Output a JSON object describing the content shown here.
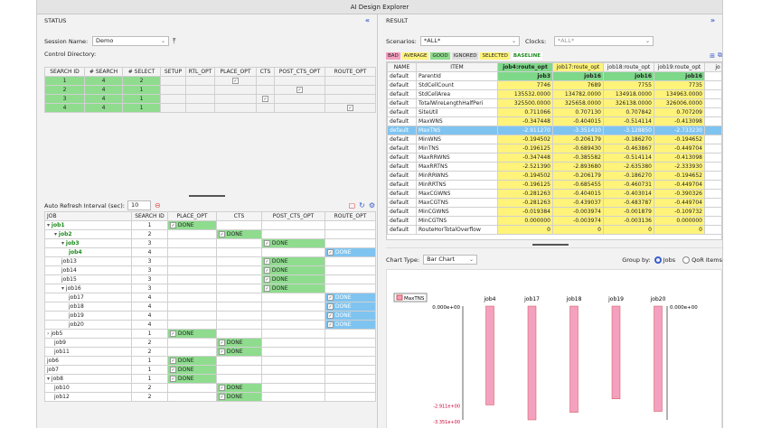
{
  "window": {
    "title": "AI Design Explorer"
  },
  "status": {
    "header": "STATUS",
    "collapse": "«",
    "session_label": "Session Name:",
    "session_value": "Demo",
    "control_dir_label": "Control Directory:",
    "table": {
      "headers": [
        "SEARCH ID",
        "# SEARCH",
        "# SELECT",
        "SETUP",
        "RTL_OPT",
        "PLACE_OPT",
        "CTS",
        "POST_CTS_OPT",
        "ROUTE_OPT"
      ],
      "rows": [
        [
          "1",
          "4",
          "2"
        ],
        [
          "2",
          "4",
          "1"
        ],
        [
          "3",
          "4",
          "1"
        ],
        [
          "4",
          "4",
          "1"
        ]
      ]
    },
    "auto_refresh_label": "Auto Refresh Interval (sec):",
    "auto_refresh_value": "10",
    "jobs_headers": [
      "JOB",
      "SEARCH ID",
      "PLACE_OPT",
      "CTS",
      "POST_CTS_OPT",
      "ROUTE_OPT"
    ],
    "done": "DONE",
    "jobs": [
      {
        "name": "job1",
        "sid": "1",
        "level": 0,
        "exp": "▾",
        "place": true,
        "cts": false,
        "post": false,
        "route": false,
        "green": true
      },
      {
        "name": "job2",
        "sid": "2",
        "level": 1,
        "exp": "▾",
        "place": false,
        "cts": true,
        "post": false,
        "route": false,
        "green": true
      },
      {
        "name": "job3",
        "sid": "3",
        "level": 2,
        "exp": "▾",
        "place": false,
        "cts": false,
        "post": true,
        "route": false,
        "green": true
      },
      {
        "name": "job4",
        "sid": "4",
        "level": 3,
        "exp": "",
        "place": false,
        "cts": false,
        "post": false,
        "route": true,
        "green": true
      },
      {
        "name": "job13",
        "sid": "3",
        "level": 2,
        "exp": "",
        "place": false,
        "cts": false,
        "post": true,
        "route": false,
        "green": false
      },
      {
        "name": "job14",
        "sid": "3",
        "level": 2,
        "exp": "",
        "place": false,
        "cts": false,
        "post": true,
        "route": false,
        "green": false
      },
      {
        "name": "job15",
        "sid": "3",
        "level": 2,
        "exp": "",
        "place": false,
        "cts": false,
        "post": true,
        "route": false,
        "green": false
      },
      {
        "name": "job16",
        "sid": "3",
        "level": 2,
        "exp": "▾",
        "place": false,
        "cts": false,
        "post": true,
        "route": false,
        "green": false
      },
      {
        "name": "job17",
        "sid": "4",
        "level": 3,
        "exp": "",
        "place": false,
        "cts": false,
        "post": false,
        "route": true,
        "green": false
      },
      {
        "name": "job18",
        "sid": "4",
        "level": 3,
        "exp": "",
        "place": false,
        "cts": false,
        "post": false,
        "route": true,
        "green": false
      },
      {
        "name": "job19",
        "sid": "4",
        "level": 3,
        "exp": "",
        "place": false,
        "cts": false,
        "post": false,
        "route": true,
        "green": false
      },
      {
        "name": "job20",
        "sid": "4",
        "level": 3,
        "exp": "",
        "place": false,
        "cts": false,
        "post": false,
        "route": true,
        "green": false
      },
      {
        "name": "job5",
        "sid": "1",
        "level": 0,
        "exp": "›",
        "place": true,
        "cts": false,
        "post": false,
        "route": false,
        "green": false
      },
      {
        "name": "job9",
        "sid": "2",
        "level": 1,
        "exp": "",
        "place": false,
        "cts": true,
        "post": false,
        "route": false,
        "green": false
      },
      {
        "name": "job11",
        "sid": "2",
        "level": 1,
        "exp": "",
        "place": false,
        "cts": true,
        "post": false,
        "route": false,
        "green": false
      },
      {
        "name": "job6",
        "sid": "1",
        "level": 0,
        "exp": "",
        "place": true,
        "cts": false,
        "post": false,
        "route": false,
        "green": false
      },
      {
        "name": "job7",
        "sid": "1",
        "level": 0,
        "exp": "",
        "place": true,
        "cts": false,
        "post": false,
        "route": false,
        "green": false
      },
      {
        "name": "job8",
        "sid": "1",
        "level": 0,
        "exp": "▾",
        "place": true,
        "cts": false,
        "post": false,
        "route": false,
        "green": false
      },
      {
        "name": "job10",
        "sid": "2",
        "level": 1,
        "exp": "",
        "place": false,
        "cts": true,
        "post": false,
        "route": false,
        "green": false
      },
      {
        "name": "job12",
        "sid": "2",
        "level": 1,
        "exp": "",
        "place": false,
        "cts": true,
        "post": false,
        "route": false,
        "green": false
      }
    ]
  },
  "result": {
    "header": "RESULT",
    "collapse": "»",
    "scenarios_label": "Scenarios:",
    "scenarios_value": "*ALL*",
    "clocks_label": "Clocks:",
    "clocks_value": "*ALL*",
    "legend": [
      "BAD",
      "AVERAGE",
      "GOOD",
      "IGNORED",
      "SELECTED",
      "BASELINE"
    ],
    "headers": [
      "NAME",
      "ITEM",
      "job4:route_opt",
      "job17:route_opt",
      "job18:route_opt",
      "job19:route_opt",
      "jo"
    ],
    "rows": [
      [
        "default",
        "ParentId",
        "job3",
        "job16",
        "job16",
        "job16"
      ],
      [
        "default",
        "StdCellCount",
        "7746",
        "7689",
        "7755",
        "7735"
      ],
      [
        "default",
        "StdCellArea",
        "135532.0000",
        "134782.0000",
        "134918.0000",
        "134963.0000"
      ],
      [
        "default",
        "TotalWireLengthHalfPeri",
        "325500.0000",
        "325658.0000",
        "326138.0000",
        "326006.0000"
      ],
      [
        "default",
        "SiteUtil",
        "0.711066",
        "0.707130",
        "0.707842",
        "0.707209"
      ],
      [
        "default",
        "MaxWNS",
        "-0.347448",
        "-0.404015",
        "-0.514114",
        "-0.413098"
      ],
      [
        "default",
        "MaxTNS",
        "-2.911270",
        "-3.351410",
        "-3.128850",
        "-2.733230"
      ],
      [
        "default",
        "MinWNS",
        "-0.194502",
        "-0.206179",
        "-0.186270",
        "-0.194652"
      ],
      [
        "default",
        "MinTNS",
        "-0.196125",
        "-0.689430",
        "-0.463867",
        "-0.449704"
      ],
      [
        "default",
        "MaxRRWNS",
        "-0.347448",
        "-0.385582",
        "-0.514114",
        "-0.413098"
      ],
      [
        "default",
        "MaxRRTNS",
        "-2.521390",
        "-2.893680",
        "-2.635380",
        "-2.333930"
      ],
      [
        "default",
        "MinRRWNS",
        "-0.194502",
        "-0.206179",
        "-0.186270",
        "-0.194652"
      ],
      [
        "default",
        "MinRRTNS",
        "-0.196125",
        "-0.685455",
        "-0.460731",
        "-0.449704"
      ],
      [
        "default",
        "MaxCGWNS",
        "-0.281263",
        "-0.404015",
        "-0.403014",
        "-0.390326"
      ],
      [
        "default",
        "MaxCGTNS",
        "-0.281263",
        "-0.439037",
        "-0.483787",
        "-0.449704"
      ],
      [
        "default",
        "MinCGWNS",
        "-0.019384",
        "-0.003974",
        "-0.001879",
        "-0.109732"
      ],
      [
        "default",
        "MinCGTNS",
        "0.000000",
        "-0.003974",
        "-0.003136",
        "0.000000"
      ],
      [
        "default",
        "RouteHorTotalOverflow",
        "0",
        "0",
        "0",
        "0"
      ]
    ],
    "chart_type_label": "Chart Type:",
    "chart_type_value": "Bar Chart",
    "group_by_label": "Group by:",
    "group_jobs": "Jobs",
    "group_qor": "QoR Items",
    "colors": {
      "bar": "#f4a0bf",
      "green": "#8fdc8f",
      "blue": "#7fc4f0",
      "yellow": "#fff37a"
    }
  },
  "chart_data": {
    "type": "bar",
    "legend": [
      "MaxTNS"
    ],
    "categories": [
      "job4",
      "job17",
      "job18",
      "job19",
      "job20"
    ],
    "series": [
      {
        "name": "MaxTNS",
        "values": [
          -2.911,
          -3.351,
          -3.129,
          -2.733,
          -3.1
        ]
      }
    ],
    "ylim": [
      -3.351,
      0
    ],
    "tick_labels": {
      "top_left": "0.000e+00",
      "top_right": "0.000e+00",
      "bottom1": "-2.911e+00",
      "bottom2": "-3.351e+00"
    }
  }
}
